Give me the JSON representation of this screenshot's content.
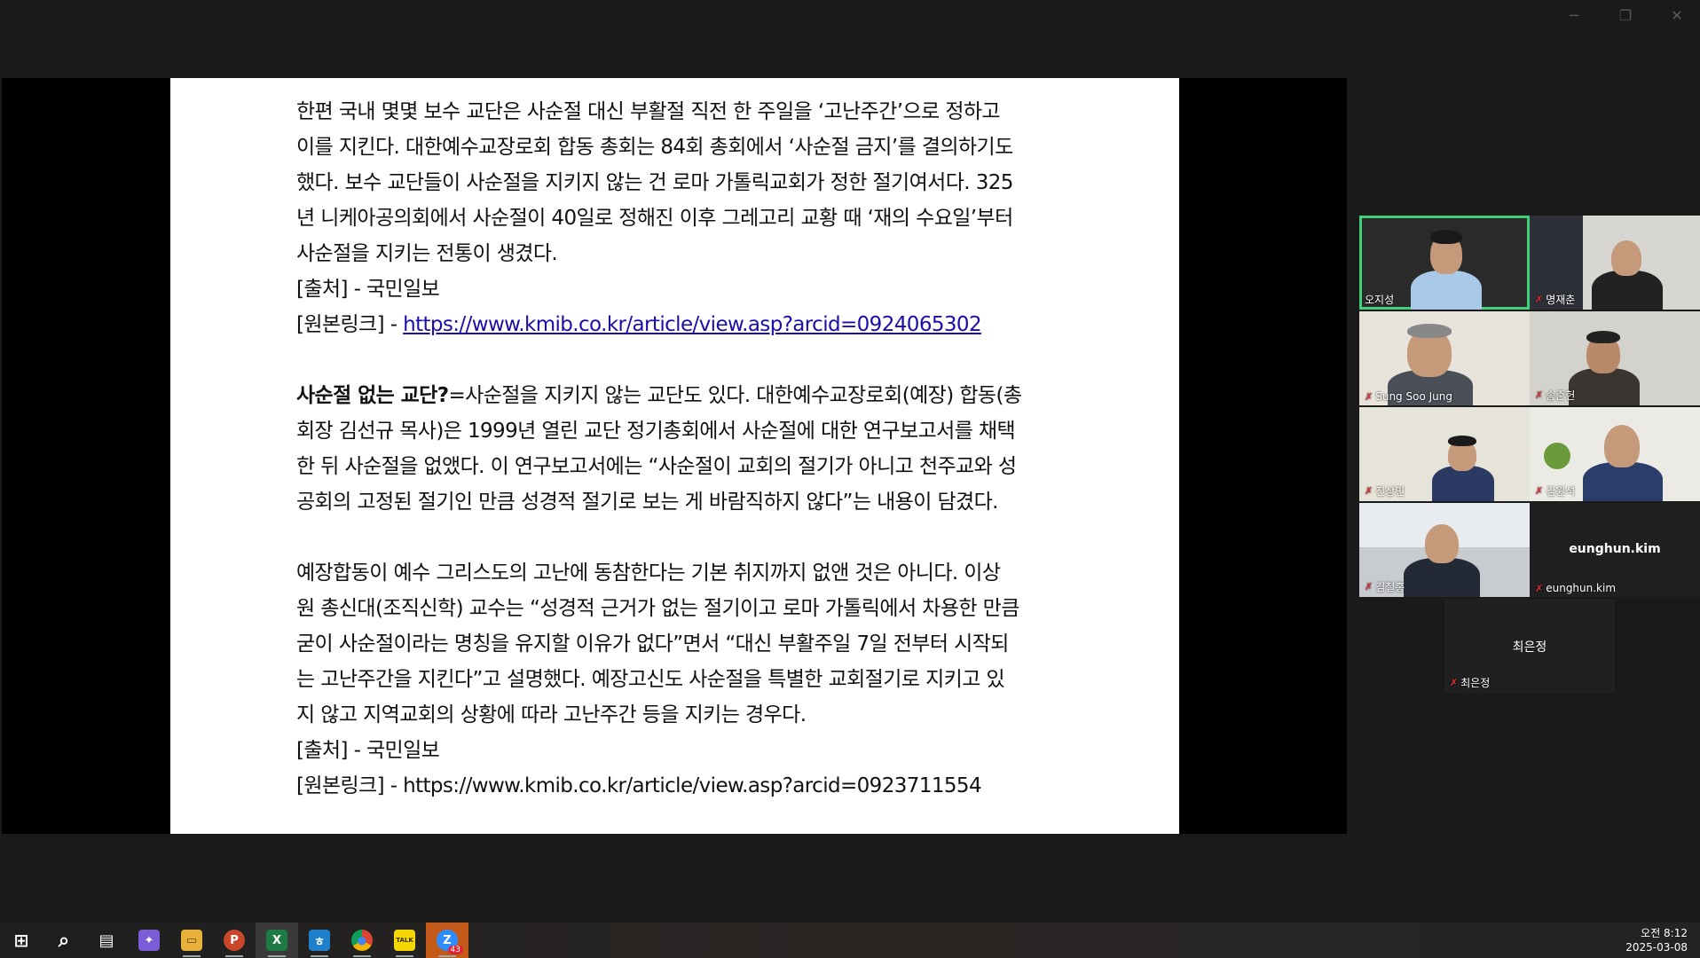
{
  "window_controls": {
    "minimize": "─",
    "restore": "❐",
    "close": "✕"
  },
  "slide": {
    "paragraphs": [
      {
        "lines": [
          "한편 국내 몇몇 보수 교단은 사순절 대신 부활절 직전 한 주일을 ‘고난주간’으로 정하고",
          "이를 지킨다. 대한예수교장로회 합동 총회는 84회 총회에서 ‘사순절 금지’를 결의하기도",
          "했다. 보수 교단들이 사순절을 지키지 않는 건 로마 가톨릭교회가 정한 절기여서다. 325",
          "년 니케아공의회에서 사순절이 40일로 정해진 이후 그레고리 교황 때 ‘재의 수요일’부터",
          "사순절을 지키는 전통이 생겼다."
        ]
      },
      {
        "source_label": "[출처] - 국민일보"
      },
      {
        "link_label": "[원본링크] - ",
        "link_url": "https://www.kmib.co.kr/article/view.asp?arcid=0924065302"
      }
    ],
    "para2_bold": "사순절 없는 교단?",
    "para2_lines": [
      "=사순절을 지키지 않는 교단도 있다. 대한예수교장로회(예장) 합동(총",
      "회장 김선규 목사)은 1999년 열린 교단 정기총회에서 사순절에 대한 연구보고서를 채택",
      "한 뒤 사순절을 없앴다. 이 연구보고서에는 “사순절이 교회의 절기가 아니고 천주교와 성",
      "공회의 고정된 절기인 만큼 성경적 절기로 보는 게 바람직하지 않다”는 내용이 담겼다."
    ],
    "para3_lines": [
      "예장합동이 예수 그리스도의 고난에 동참한다는 기본 취지까지 없앤 것은 아니다. 이상",
      "원 총신대(조직신학) 교수는 “성경적 근거가 없는 절기이고 로마 가톨릭에서 차용한 만큼",
      "굳이 사순절이라는 명칭을 유지할 이유가 없다”면서 “대신 부활주일 7일 전부터 시작되",
      "는 고난주간을 지킨다”고 설명했다. 예장고신도 사순절을 특별한 교회절기로 지키고 있",
      "지 않고 지역교회의 상황에 따라 고난주간 등을 지키는 경우다."
    ],
    "source2": "[출처] - 국민일보",
    "link2": "[원본링크] - https://www.kmib.co.kr/article/view.asp?arcid=0923711554"
  },
  "participants": [
    {
      "name": "오지성",
      "muted": false,
      "active": true,
      "video": true,
      "bg": "#8f8c88",
      "shirt": "#a9c9e8"
    },
    {
      "name": "명재춘",
      "muted": true,
      "active": false,
      "video": true,
      "bg": "#d8d6d0",
      "shirt": "#222"
    },
    {
      "name": "Sung Soo Jung",
      "muted": true,
      "active": false,
      "video": true,
      "bg": "#e8e4dc",
      "shirt": "#4a4f58"
    },
    {
      "name": "송준헌",
      "muted": true,
      "active": false,
      "video": true,
      "bg": "#d4d2cc",
      "shirt": "#3a3530"
    },
    {
      "name": "진상민",
      "muted": true,
      "active": false,
      "video": true,
      "bg": "#e6e4d8",
      "shirt": "#2b3a63"
    },
    {
      "name": "김원석",
      "muted": true,
      "active": false,
      "video": true,
      "bg": "#eceae4",
      "shirt": "#2a3d6b"
    },
    {
      "name": "김철홍",
      "muted": true,
      "active": false,
      "video": true,
      "bg": "#c8ccd0",
      "shirt": "#232a36"
    },
    {
      "name": "eunghun.kim",
      "muted": true,
      "active": false,
      "video": false,
      "display": "eunghun.kim"
    },
    {
      "name": "최은정",
      "muted": true,
      "active": false,
      "video": false,
      "display": "최은정"
    }
  ],
  "taskbar": {
    "apps": [
      {
        "name": "windows-start-icon",
        "glyph": "⊞",
        "color": "transparent"
      },
      {
        "name": "search-icon",
        "glyph": "⌕",
        "color": "transparent"
      },
      {
        "name": "task-view-icon",
        "glyph": "▤",
        "color": "transparent"
      },
      {
        "name": "copilot-icon",
        "glyph": "✦",
        "color": "#7b5cd6"
      },
      {
        "name": "file-explorer-icon",
        "glyph": "▭",
        "color": "#e8b23a"
      },
      {
        "name": "powerpoint-icon",
        "glyph": "P",
        "color": "#c9472a"
      },
      {
        "name": "excel-icon",
        "glyph": "X",
        "color": "#1d7a45"
      },
      {
        "name": "hangul-icon",
        "glyph": "ㅎ",
        "color": "#1f7fc9"
      },
      {
        "name": "chrome-icon",
        "glyph": "●",
        "color": "#3c8f3c"
      },
      {
        "name": "kakaotalk-icon",
        "glyph": "TALK",
        "color": "#f5d800"
      },
      {
        "name": "zoom-icon",
        "glyph": "Z",
        "color": "#ffffff",
        "badge": "43"
      }
    ],
    "clock_time": "오전 8:12",
    "clock_date": "2025-03-08"
  }
}
